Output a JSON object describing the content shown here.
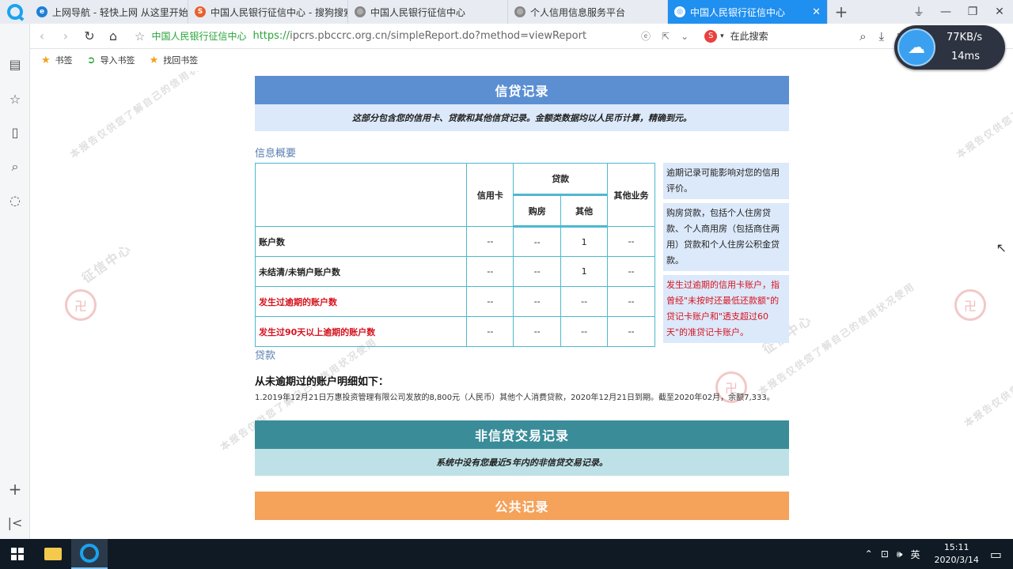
{
  "tabs": [
    {
      "label": "上网导航 - 轻快上网 从这里开始",
      "icon": "ie-icon",
      "color": "#1e7fd8",
      "glyph": "e"
    },
    {
      "label": "中国人民银行征信中心 - 搜狗搜索",
      "icon": "sogou-icon",
      "color": "#e8612c",
      "glyph": "S"
    },
    {
      "label": "中国人民银行征信中心",
      "icon": "globe-icon",
      "color": "#888888",
      "glyph": "◎"
    },
    {
      "label": "个人信用信息服务平台",
      "icon": "globe-icon",
      "color": "#888888",
      "glyph": "◎"
    },
    {
      "label": "中国人民银行征信中心",
      "icon": "globe-icon",
      "color": "#1f8ff0",
      "glyph": "◎",
      "active": true
    }
  ],
  "address": {
    "site_name": "中国人民银行征信中心",
    "protocol": "https://",
    "url": "ipcrs.pbccrc.org.cn/simpleReport.do?method=viewReport",
    "search_placeholder": "在此搜索"
  },
  "bookmarks": [
    {
      "label": "书签",
      "icon": "star-icon"
    },
    {
      "label": "导入书签",
      "icon": "import-icon"
    },
    {
      "label": "找回书签",
      "icon": "star-icon"
    }
  ],
  "speed": {
    "rate": "77KB/s",
    "latency": "14ms"
  },
  "watermark": {
    "text": "本报告仅供您了解自己的信用状况使用",
    "seal": "征信中心"
  },
  "credit": {
    "title": "信贷记录",
    "subtitle": "这部分包含您的信用卡、贷款和其他信贷记录。金额类数据均以人民币计算，精确到元。",
    "summary_title": "信息概要",
    "headers": {
      "credit_card": "信用卡",
      "loan": "贷款",
      "housing": "购房",
      "other_loan": "其他",
      "other_business": "其他业务"
    },
    "rows": [
      {
        "label": "账户数",
        "red": false,
        "values": [
          "--",
          "--",
          "1",
          "--"
        ]
      },
      {
        "label": "未结清/未销户账户数",
        "red": false,
        "values": [
          "--",
          "--",
          "1",
          "--"
        ]
      },
      {
        "label": "发生过逾期的账户数",
        "red": true,
        "values": [
          "--",
          "--",
          "--",
          "--"
        ]
      },
      {
        "label": "发生过90天以上逾期的账户数",
        "red": true,
        "values": [
          "--",
          "--",
          "--",
          "--"
        ]
      }
    ],
    "notes": [
      {
        "text": "逾期记录可能影响对您的信用评价。",
        "red": false
      },
      {
        "text": "购房贷款，包括个人住房贷款、个人商用房（包括商住两用）贷款和个人住房公积金贷款。",
        "red": false
      },
      {
        "text": "发生过逾期的信用卡账户，指曾经\"未按时还最低还款额\"的贷记卡账户和\"透支超过60天\"的准贷记卡账户。",
        "red": true
      }
    ],
    "loan_section": "贷款",
    "loan_heading": "从未逾期过的账户明细如下：",
    "loan_detail": "1.2019年12月21日万惠投资管理有限公司发放的8,800元（人民币）其他个人消费贷款，2020年12月21日到期。截至2020年02月，余额7,333。"
  },
  "noncredit": {
    "title": "非信贷交易记录",
    "subtitle": "系统中没有您最近5年内的非信贷交易记录。"
  },
  "public": {
    "title": "公共记录"
  },
  "taskbar": {
    "ime": "英",
    "time": "15:11",
    "date": "2020/3/14"
  }
}
